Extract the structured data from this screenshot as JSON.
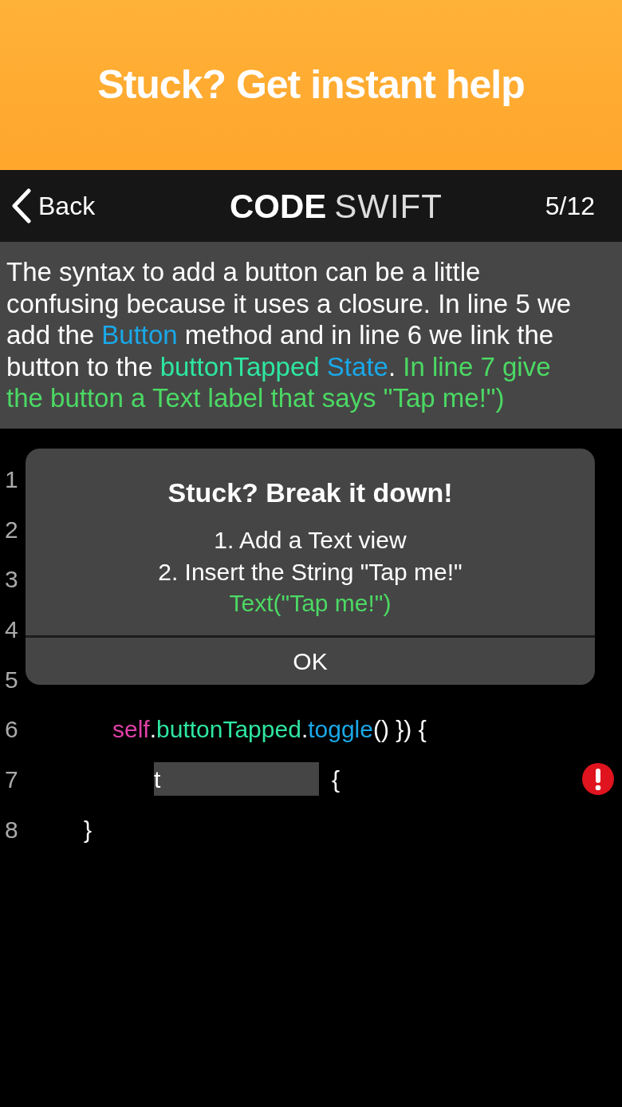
{
  "banner": {
    "text": "Stuck? Get instant help"
  },
  "nav": {
    "back": "Back",
    "title_bold": "CODE",
    "title_light": "SWIFT",
    "counter": "5/12"
  },
  "instructions": [
    {
      "kind": "plain",
      "text": "The syntax to add a button can be a little confusing because it uses a closure.  In line 5 we add the "
    },
    {
      "kind": "type",
      "text": "Button"
    },
    {
      "kind": "plain",
      "text": " method and in line 6 we link the button to the "
    },
    {
      "kind": "property",
      "text": "buttonTapped "
    },
    {
      "kind": "type",
      "text": "State"
    },
    {
      "kind": "plain",
      "text": ".  "
    },
    {
      "kind": "hint",
      "text": "In line 7 give the button a Text label that says \"Tap me!\")"
    }
  ],
  "code_lines": [
    {
      "number": "1"
    },
    {
      "number": "2"
    },
    {
      "number": "3"
    },
    {
      "number": "4"
    },
    {
      "number": "5"
    },
    {
      "number": "6",
      "tokens": [
        {
          "kind": "self",
          "text": "self"
        },
        {
          "kind": "plain",
          "text": "."
        },
        {
          "kind": "property",
          "text": "buttonTapped"
        },
        {
          "kind": "plain",
          "text": "."
        },
        {
          "kind": "type",
          "text": "toggle"
        },
        {
          "kind": "plain",
          "text": "() }) {"
        }
      ]
    },
    {
      "number": "7",
      "error": true,
      "tokens": [
        {
          "kind": "input",
          "value": "t"
        },
        {
          "kind": "plain",
          "text": "{"
        }
      ]
    },
    {
      "number": "8",
      "tokens": [
        {
          "kind": "plain",
          "text": "}"
        }
      ]
    }
  ],
  "alert": {
    "title": "Stuck? Break it down!",
    "lines": [
      "1. Add a Text view",
      "2. Insert the String \"Tap me!\""
    ],
    "hint": "Text(\"Tap me!\")",
    "button": "OK"
  }
}
